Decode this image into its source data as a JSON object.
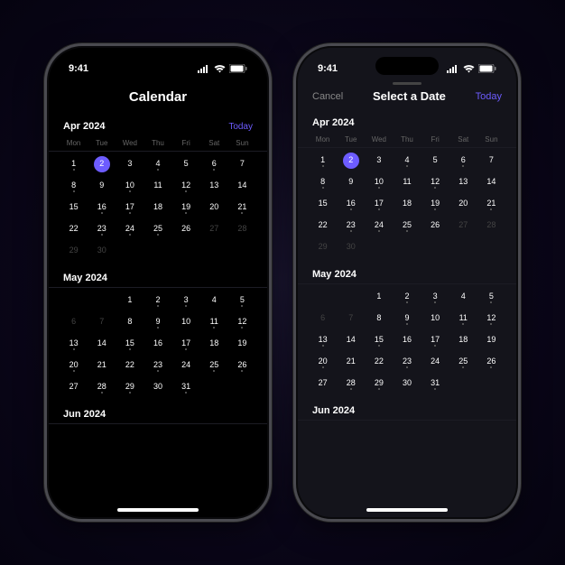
{
  "status": {
    "time": "9:41"
  },
  "accent": "#6d5cff",
  "phone1": {
    "title": "Calendar",
    "today": "Today",
    "month1": "Apr 2024",
    "month2": "May 2024",
    "month3": "Jun 2024",
    "weekdays": [
      "Mon",
      "Tue",
      "Wed",
      "Thu",
      "Fri",
      "Sat",
      "Sun"
    ],
    "april": [
      {
        "n": 1,
        "dot": true
      },
      {
        "n": 2,
        "selected": true
      },
      {
        "n": 3
      },
      {
        "n": 4,
        "dot": true
      },
      {
        "n": 5
      },
      {
        "n": 6,
        "dot": true
      },
      {
        "n": 7
      },
      {
        "n": 8,
        "dot": true
      },
      {
        "n": 9
      },
      {
        "n": 10,
        "dot": true
      },
      {
        "n": 11
      },
      {
        "n": 12,
        "dot": true
      },
      {
        "n": 13
      },
      {
        "n": 14
      },
      {
        "n": 15
      },
      {
        "n": 16,
        "dot": true
      },
      {
        "n": 17,
        "dot": true
      },
      {
        "n": 18
      },
      {
        "n": 19,
        "dot": true
      },
      {
        "n": 20
      },
      {
        "n": 21,
        "dot": true
      },
      {
        "n": 22
      },
      {
        "n": 23,
        "dot": true
      },
      {
        "n": 24,
        "dot": true
      },
      {
        "n": 25,
        "dot": true
      },
      {
        "n": 26
      },
      {
        "n": 27,
        "muted": true
      },
      {
        "n": 28,
        "muted": true
      },
      {
        "n": 29,
        "muted": true
      },
      {
        "n": 30,
        "muted": true
      }
    ],
    "may": [
      {
        "n": 1
      },
      {
        "n": 2,
        "dot": true
      },
      {
        "n": 3,
        "dot": true
      },
      {
        "n": 4
      },
      {
        "n": 5,
        "dot": true
      },
      {
        "n": 6,
        "muted": true
      },
      {
        "n": 7,
        "muted": true
      },
      {
        "n": 8
      },
      {
        "n": 9,
        "dot": true
      },
      {
        "n": 10
      },
      {
        "n": 11,
        "dot": true
      },
      {
        "n": 12,
        "dot": true
      },
      {
        "n": 13,
        "dot": true
      },
      {
        "n": 14
      },
      {
        "n": 15,
        "dot": true
      },
      {
        "n": 16
      },
      {
        "n": 17,
        "dot": true
      },
      {
        "n": 18
      },
      {
        "n": 19
      },
      {
        "n": 20,
        "dot": true
      },
      {
        "n": 21
      },
      {
        "n": 22
      },
      {
        "n": 23,
        "dot": true
      },
      {
        "n": 24
      },
      {
        "n": 25,
        "dot": true
      },
      {
        "n": 26,
        "dot": true
      },
      {
        "n": 27
      },
      {
        "n": 28,
        "dot": true
      },
      {
        "n": 29,
        "dot": true
      },
      {
        "n": 30
      },
      {
        "n": 31,
        "dot": true
      }
    ]
  },
  "phone2": {
    "cancel": "Cancel",
    "title": "Select a Date",
    "today": "Today",
    "month1": "Apr 2024",
    "month2": "May 2024",
    "month3": "Jun 2024",
    "weekdays": [
      "Mon",
      "Tue",
      "Wed",
      "Thu",
      "Fri",
      "Sat",
      "Sun"
    ],
    "april": [
      {
        "n": 1,
        "dot": true
      },
      {
        "n": 2,
        "selected": true
      },
      {
        "n": 3
      },
      {
        "n": 4,
        "dot": true
      },
      {
        "n": 5
      },
      {
        "n": 6,
        "dot": true
      },
      {
        "n": 7
      },
      {
        "n": 8,
        "dot": true
      },
      {
        "n": 9
      },
      {
        "n": 10,
        "dot": true
      },
      {
        "n": 11
      },
      {
        "n": 12,
        "dot": true
      },
      {
        "n": 13
      },
      {
        "n": 14
      },
      {
        "n": 15
      },
      {
        "n": 16,
        "dot": true
      },
      {
        "n": 17,
        "dot": true
      },
      {
        "n": 18
      },
      {
        "n": 19,
        "dot": true
      },
      {
        "n": 20
      },
      {
        "n": 21,
        "dot": true
      },
      {
        "n": 22
      },
      {
        "n": 23,
        "dot": true
      },
      {
        "n": 24,
        "dot": true
      },
      {
        "n": 25,
        "dot": true
      },
      {
        "n": 26
      },
      {
        "n": 27,
        "muted": true
      },
      {
        "n": 28,
        "muted": true
      },
      {
        "n": 29,
        "muted": true
      },
      {
        "n": 30,
        "muted": true
      }
    ],
    "may": [
      {
        "n": 1
      },
      {
        "n": 2,
        "dot": true
      },
      {
        "n": 3,
        "dot": true
      },
      {
        "n": 4
      },
      {
        "n": 5,
        "dot": true
      },
      {
        "n": 6,
        "muted": true
      },
      {
        "n": 7,
        "muted": true
      },
      {
        "n": 8
      },
      {
        "n": 9,
        "dot": true
      },
      {
        "n": 10
      },
      {
        "n": 11,
        "dot": true
      },
      {
        "n": 12,
        "dot": true
      },
      {
        "n": 13,
        "dot": true
      },
      {
        "n": 14
      },
      {
        "n": 15,
        "dot": true
      },
      {
        "n": 16
      },
      {
        "n": 17,
        "dot": true
      },
      {
        "n": 18
      },
      {
        "n": 19
      },
      {
        "n": 20,
        "dot": true
      },
      {
        "n": 21
      },
      {
        "n": 22
      },
      {
        "n": 23,
        "dot": true
      },
      {
        "n": 24
      },
      {
        "n": 25,
        "dot": true
      },
      {
        "n": 26,
        "dot": true
      },
      {
        "n": 27
      },
      {
        "n": 28,
        "dot": true
      },
      {
        "n": 29,
        "dot": true
      },
      {
        "n": 30
      },
      {
        "n": 31,
        "dot": true
      }
    ]
  }
}
